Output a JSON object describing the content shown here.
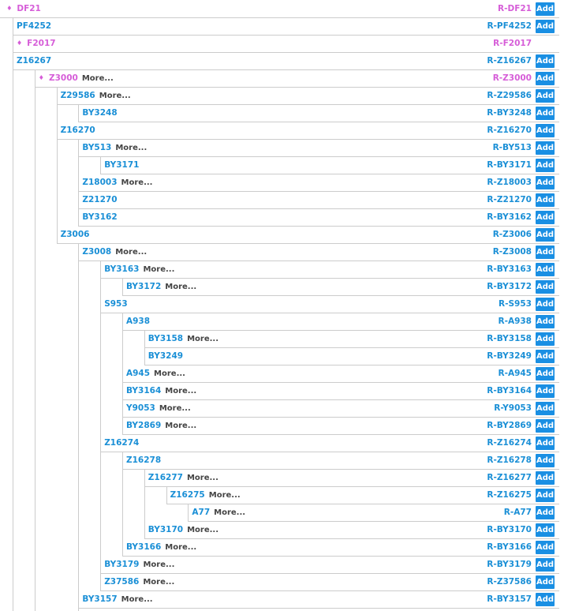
{
  "colors": {
    "link": "#1a8fd6",
    "highlight": "#d65dd8",
    "more": "#444444",
    "line": "#cccccc",
    "add_bg": "#1a8fe3",
    "add_text": "#ffffff"
  },
  "labels": {
    "more": "More...",
    "add": "Add"
  },
  "rows": [
    {
      "name": "DF21",
      "level": 0,
      "highlight": true,
      "more": false,
      "rname": "R-DF21",
      "add": true
    },
    {
      "name": "PF4252",
      "level": 1,
      "highlight": false,
      "more": false,
      "rname": "R-PF4252",
      "add": true
    },
    {
      "name": "F2017",
      "level": 1,
      "highlight": true,
      "more": false,
      "rname": "R-F2017",
      "add": false
    },
    {
      "name": "Z16267",
      "level": 1,
      "highlight": false,
      "more": false,
      "rname": "R-Z16267",
      "add": true
    },
    {
      "name": "Z3000",
      "level": 2,
      "highlight": true,
      "more": true,
      "rname": "R-Z3000",
      "add": true
    },
    {
      "name": "Z29586",
      "level": 3,
      "highlight": false,
      "more": true,
      "rname": "R-Z29586",
      "add": true
    },
    {
      "name": "BY3248",
      "level": 4,
      "highlight": false,
      "more": false,
      "rname": "R-BY3248",
      "add": true
    },
    {
      "name": "Z16270",
      "level": 3,
      "highlight": false,
      "more": false,
      "rname": "R-Z16270",
      "add": true
    },
    {
      "name": "BY513",
      "level": 4,
      "highlight": false,
      "more": true,
      "rname": "R-BY513",
      "add": true
    },
    {
      "name": "BY3171",
      "level": 5,
      "highlight": false,
      "more": false,
      "rname": "R-BY3171",
      "add": true
    },
    {
      "name": "Z18003",
      "level": 4,
      "highlight": false,
      "more": true,
      "rname": "R-Z18003",
      "add": true
    },
    {
      "name": "Z21270",
      "level": 4,
      "highlight": false,
      "more": false,
      "rname": "R-Z21270",
      "add": true
    },
    {
      "name": "BY3162",
      "level": 4,
      "highlight": false,
      "more": false,
      "rname": "R-BY3162",
      "add": true
    },
    {
      "name": "Z3006",
      "level": 3,
      "highlight": false,
      "more": false,
      "rname": "R-Z3006",
      "add": true
    },
    {
      "name": "Z3008",
      "level": 4,
      "highlight": false,
      "more": true,
      "rname": "R-Z3008",
      "add": true
    },
    {
      "name": "BY3163",
      "level": 5,
      "highlight": false,
      "more": true,
      "rname": "R-BY3163",
      "add": true
    },
    {
      "name": "BY3172",
      "level": 6,
      "highlight": false,
      "more": true,
      "rname": "R-BY3172",
      "add": true
    },
    {
      "name": "S953",
      "level": 5,
      "highlight": false,
      "more": false,
      "rname": "R-S953",
      "add": true
    },
    {
      "name": "A938",
      "level": 6,
      "highlight": false,
      "more": false,
      "rname": "R-A938",
      "add": true
    },
    {
      "name": "BY3158",
      "level": 7,
      "highlight": false,
      "more": true,
      "rname": "R-BY3158",
      "add": true
    },
    {
      "name": "BY3249",
      "level": 7,
      "highlight": false,
      "more": false,
      "rname": "R-BY3249",
      "add": true
    },
    {
      "name": "A945",
      "level": 6,
      "highlight": false,
      "more": true,
      "rname": "R-A945",
      "add": true
    },
    {
      "name": "BY3164",
      "level": 6,
      "highlight": false,
      "more": true,
      "rname": "R-BY3164",
      "add": true
    },
    {
      "name": "Y9053",
      "level": 6,
      "highlight": false,
      "more": true,
      "rname": "R-Y9053",
      "add": true
    },
    {
      "name": "BY2869",
      "level": 6,
      "highlight": false,
      "more": true,
      "rname": "R-BY2869",
      "add": true
    },
    {
      "name": "Z16274",
      "level": 5,
      "highlight": false,
      "more": false,
      "rname": "R-Z16274",
      "add": true
    },
    {
      "name": "Z16278",
      "level": 6,
      "highlight": false,
      "more": false,
      "rname": "R-Z16278",
      "add": true
    },
    {
      "name": "Z16277",
      "level": 7,
      "highlight": false,
      "more": true,
      "rname": "R-Z16277",
      "add": true
    },
    {
      "name": "Z16275",
      "level": 8,
      "highlight": false,
      "more": true,
      "rname": "R-Z16275",
      "add": true
    },
    {
      "name": "A77",
      "level": 9,
      "highlight": false,
      "more": true,
      "rname": "R-A77",
      "add": true
    },
    {
      "name": "BY3170",
      "level": 7,
      "highlight": false,
      "more": true,
      "rname": "R-BY3170",
      "add": true
    },
    {
      "name": "BY3166",
      "level": 6,
      "highlight": false,
      "more": true,
      "rname": "R-BY3166",
      "add": true
    },
    {
      "name": "BY3179",
      "level": 5,
      "highlight": false,
      "more": true,
      "rname": "R-BY3179",
      "add": true
    },
    {
      "name": "Z37586",
      "level": 5,
      "highlight": false,
      "more": true,
      "rname": "R-Z37586",
      "add": true
    },
    {
      "name": "BY3157",
      "level": 4,
      "highlight": false,
      "more": true,
      "rname": "R-BY3157",
      "add": true
    }
  ]
}
